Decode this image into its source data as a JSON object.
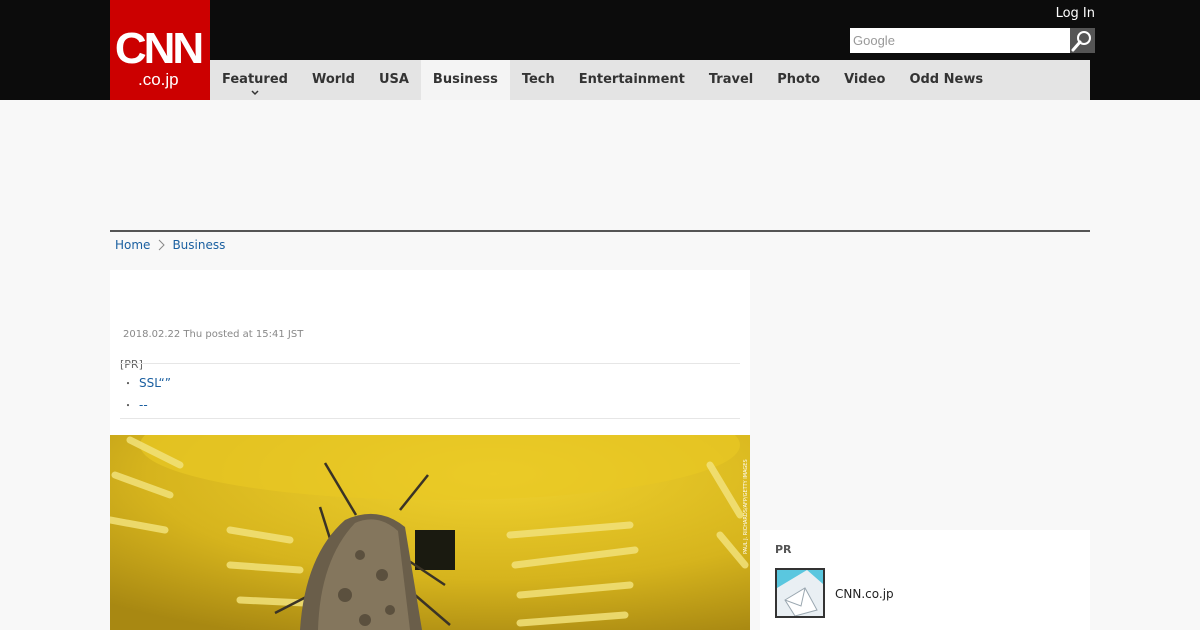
{
  "header": {
    "logo_top": "CNN",
    "logo_bottom": ".co.jp",
    "login_label": "Log In",
    "search_placeholder": "Google",
    "nav": [
      {
        "label": "Featured"
      },
      {
        "label": "World"
      },
      {
        "label": "USA"
      },
      {
        "label": "Business"
      },
      {
        "label": "Tech"
      },
      {
        "label": "Entertainment"
      },
      {
        "label": "Travel"
      },
      {
        "label": "Photo"
      },
      {
        "label": "Video"
      },
      {
        "label": "Odd News"
      }
    ],
    "active_nav": "Business"
  },
  "breadcrumb": {
    "home": "Home",
    "current": "Business"
  },
  "article": {
    "posted": "2018.02.22 Thu posted at 15:41 JST",
    "pr_label": "[PR]",
    "pr_links": [
      {
        "bullet": "・",
        "label": "SSL“”"
      },
      {
        "bullet": "・",
        "label": "--"
      }
    ],
    "photo_credit": "PAUL J. RICHARDS/AFP/GETTY IMAGES"
  },
  "sidebar": {
    "pr_title": "PR",
    "pr_item_text": "CNN.co.jp"
  },
  "colors": {
    "brand_red": "#cc0000",
    "top_bar": "#0c0c0c",
    "nav_bg": "#e4e4e4",
    "link": "#1a5fa0"
  }
}
